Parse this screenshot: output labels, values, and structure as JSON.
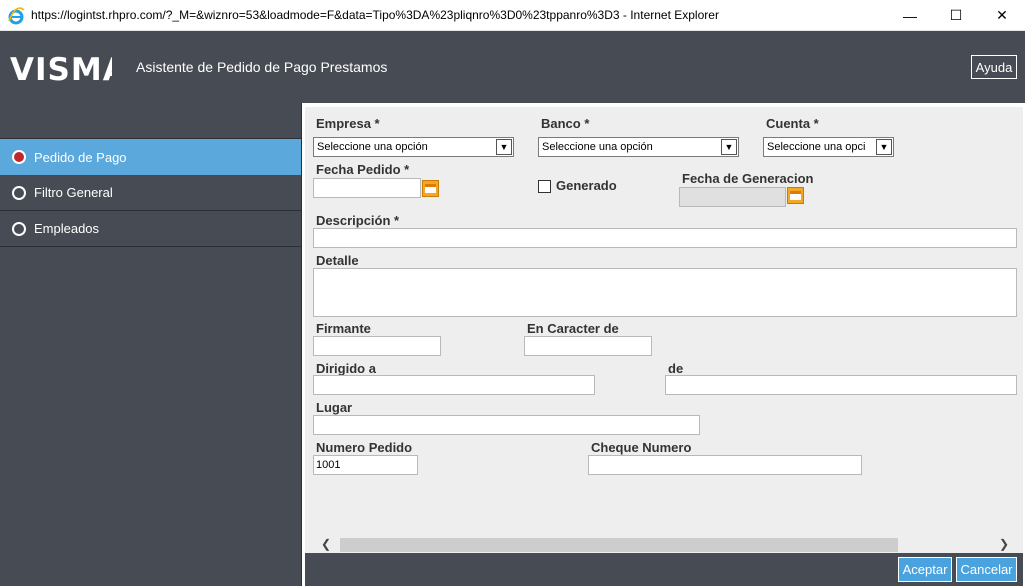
{
  "window": {
    "title": "https://logintst.rhpro.com/?_M=&wiznro=53&loadmode=F&data=Tipo%3DA%23pliqnro%3D0%23tppanro%3D3  - Internet Explorer",
    "minimize": "—",
    "maximize": "☐",
    "close": "✕"
  },
  "header": {
    "logo": "VISMA",
    "title": "Asistente de Pedido de Pago Prestamos",
    "help_label": "Ayuda"
  },
  "sidebar": {
    "items": [
      {
        "label": "Pedido de Pago",
        "active": true
      },
      {
        "label": "Filtro General",
        "active": false
      },
      {
        "label": "Empleados",
        "active": false
      }
    ]
  },
  "form": {
    "empresa_label": "Empresa *",
    "empresa_value": "Seleccione una opción",
    "banco_label": "Banco *",
    "banco_value": "Seleccione una opción",
    "cuenta_label": "Cuenta *",
    "cuenta_value": "Seleccione una opci",
    "fecha_pedido_label": "Fecha Pedido *",
    "fecha_pedido_value": "",
    "generado_label": "Generado",
    "fecha_generacion_label": "Fecha de Generacion",
    "descripcion_label": "Descripción *",
    "detalle_label": "Detalle",
    "firmante_label": "Firmante",
    "en_caracter_label": "En Caracter de",
    "dirigido_label": "Dirigido a",
    "de_label": "de",
    "lugar_label": "Lugar",
    "numero_pedido_label": "Numero Pedido",
    "numero_pedido_value": "1001",
    "cheque_label": "Cheque Numero"
  },
  "footer": {
    "accept_label": "Aceptar",
    "cancel_label": "Cancelar"
  },
  "scroll": {
    "left": "❮",
    "right": "❯"
  },
  "colors": {
    "header_bg": "#474b53",
    "accent": "#4aa3df",
    "active_nav": "#5aa8dc",
    "content_bg": "#eeeeee"
  }
}
